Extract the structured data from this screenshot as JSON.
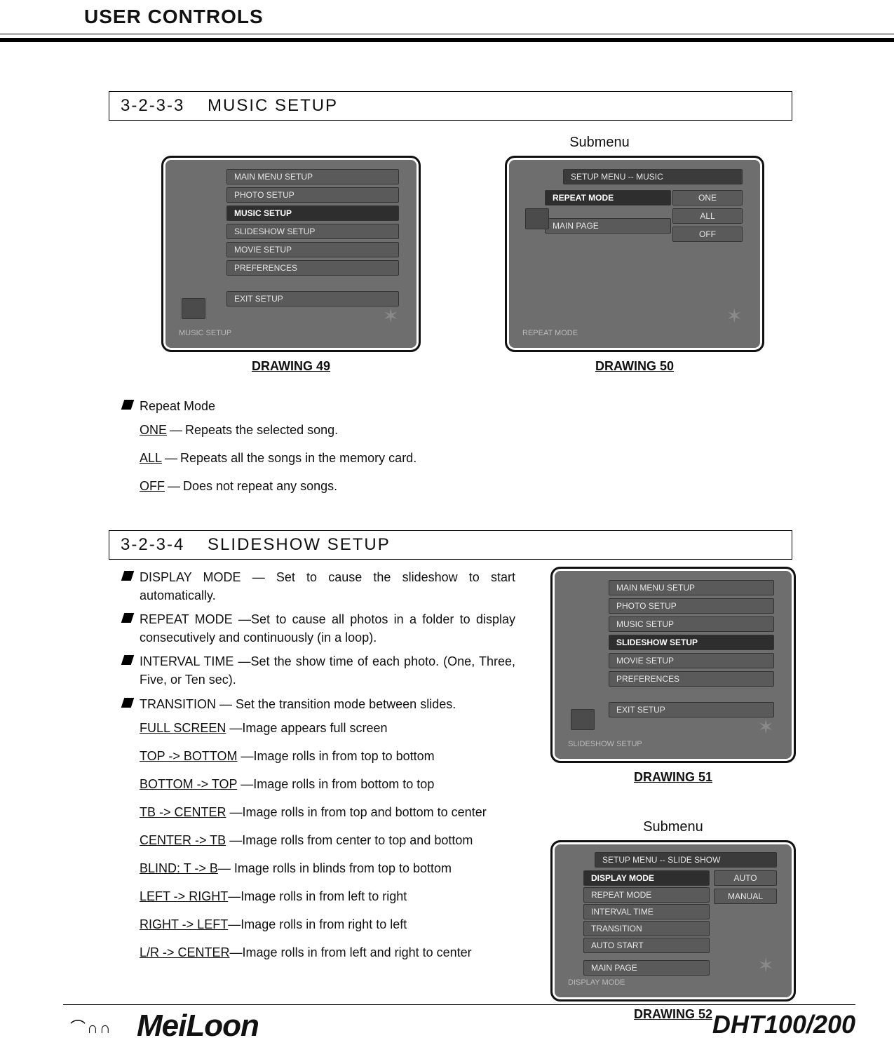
{
  "header": {
    "title": "USER CONTROLS"
  },
  "section1": {
    "number": "3-2-3-3",
    "title": "MUSIC SETUP",
    "submenu_label": "Submenu",
    "screens": {
      "left": {
        "menu": [
          "MAIN MENU SETUP",
          "PHOTO SETUP",
          "MUSIC SETUP",
          "SLIDESHOW SETUP",
          "MOVIE SETUP",
          "PREFERENCES",
          "EXIT SETUP"
        ],
        "selected_index": 2,
        "footer": "MUSIC SETUP",
        "caption": "DRAWING 49"
      },
      "right": {
        "header": "SETUP MENU -- MUSIC",
        "items": [
          "REPEAT MODE",
          "MAIN PAGE"
        ],
        "selected_item": 0,
        "options": [
          "ONE",
          "ALL",
          "OFF"
        ],
        "footer": "REPEAT MODE",
        "caption": "DRAWING 50"
      }
    },
    "repeat_mode": {
      "label": "Repeat Mode",
      "options": [
        {
          "term": "ONE",
          "desc": "Repeats the selected song."
        },
        {
          "term": "ALL",
          "desc": "Repeats all the songs in the memory card."
        },
        {
          "term": "OFF",
          "desc": "Does not repeat any songs."
        }
      ]
    }
  },
  "section2": {
    "number": "3-2-3-4",
    "title": "SLIDESHOW SETUP",
    "bullets": [
      {
        "label": "DISPLAY MODE",
        "desc": "Set to cause the slideshow to start automatically."
      },
      {
        "label": "REPEAT MODE",
        "desc": "Set to cause all photos in a folder to display consecutively and continuously (in a loop)."
      },
      {
        "label": "INTERVAL TIME",
        "desc": "Set the show time of each photo. (One, Three, Five, or Ten sec)."
      },
      {
        "label": "TRANSITION",
        "desc": "Set the transition mode between slides."
      }
    ],
    "transitions": [
      {
        "term": "FULL SCREEN",
        "desc": "Image appears full screen"
      },
      {
        "term": "TOP -> BOTTOM",
        "desc": "Image rolls in from top to bottom"
      },
      {
        "term": "BOTTOM -> TOP",
        "desc": "Image rolls in from bottom to top"
      },
      {
        "term": "TB -> CENTER",
        "desc": "Image rolls in from top and bottom to center"
      },
      {
        "term": "CENTER -> TB",
        "desc": "Image rolls from center to top and bottom"
      },
      {
        "term": "BLIND: T -> B",
        "desc": "Image rolls in blinds from top to bottom"
      },
      {
        "term": "LEFT -> RIGHT",
        "desc": "Image rolls in from left to right"
      },
      {
        "term": "RIGHT -> LEFT",
        "desc": "Image rolls in from right to left"
      },
      {
        "term": "L/R -> CENTER",
        "desc": "Image rolls in from left and right to center"
      }
    ],
    "submenu_label": "Submenu",
    "screens": {
      "top": {
        "menu": [
          "MAIN MENU SETUP",
          "PHOTO SETUP",
          "MUSIC SETUP",
          "SLIDESHOW SETUP",
          "MOVIE SETUP",
          "PREFERENCES",
          "EXIT SETUP"
        ],
        "selected_index": 3,
        "footer": "SLIDESHOW SETUP",
        "caption": "DRAWING 51"
      },
      "bottom": {
        "header": "SETUP MENU -- SLIDE SHOW",
        "items": [
          "DISPLAY MODE",
          "REPEAT MODE",
          "INTERVAL TIME",
          "TRANSITION",
          "AUTO START",
          "MAIN PAGE"
        ],
        "selected_item": 0,
        "options": [
          "AUTO",
          "MANUAL"
        ],
        "footer": "DISPLAY MODE",
        "caption": "DRAWING 52"
      }
    }
  },
  "footer": {
    "page_indicator": "⌒∩∩",
    "brand": "MeiLoon",
    "model": "DHT100/200"
  }
}
